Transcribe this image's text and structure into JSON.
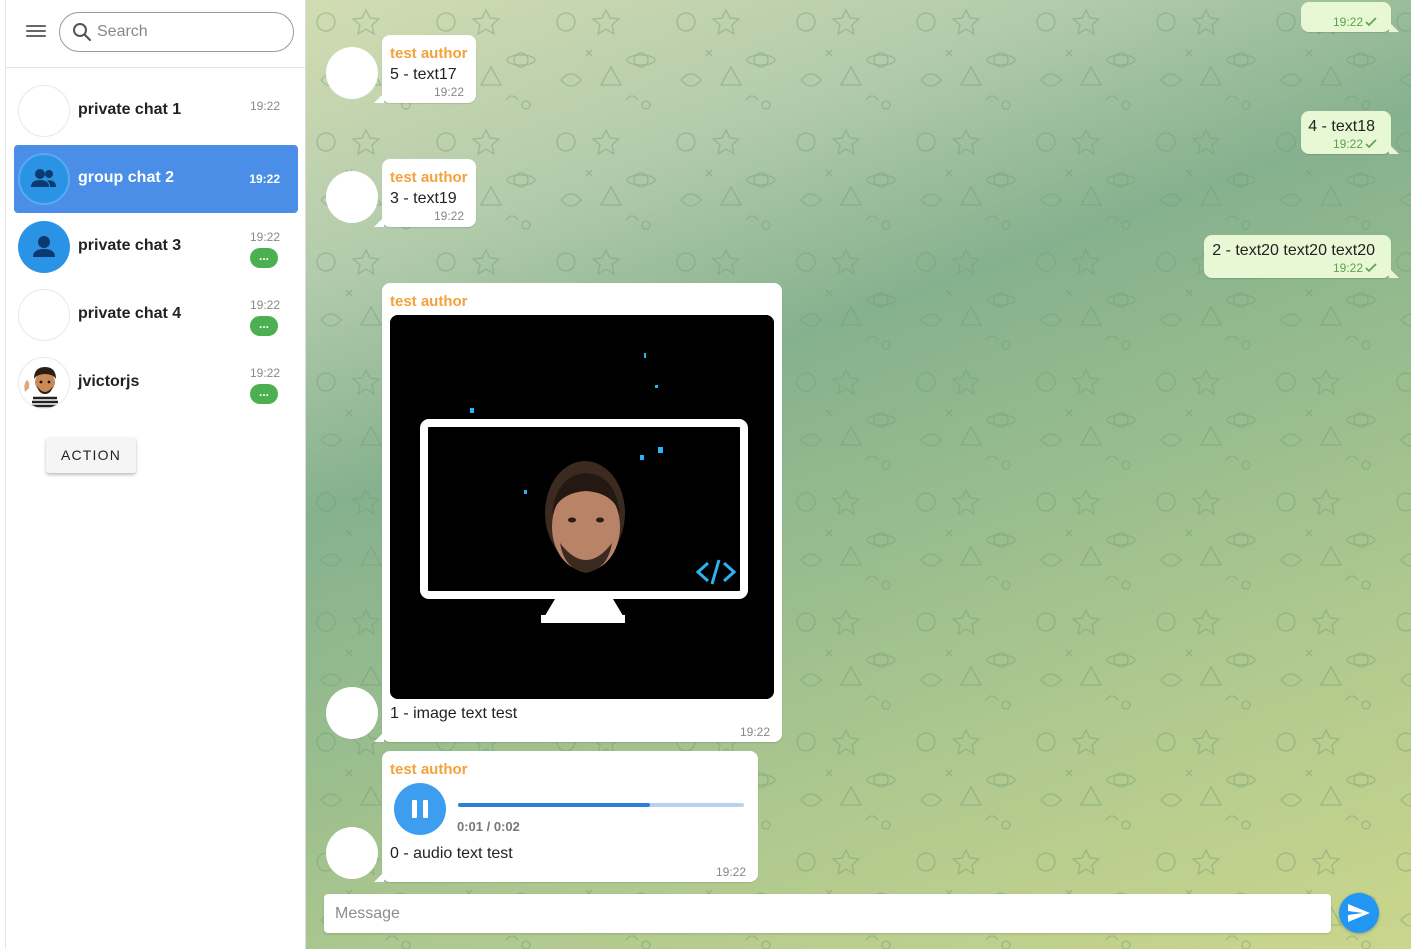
{
  "sidebar": {
    "search": {
      "placeholder": "Search"
    },
    "chats": [
      {
        "name": "private chat 1",
        "time": "19:22",
        "badge": "",
        "avatar": "blank"
      },
      {
        "name": "group chat 2",
        "time": "19:22",
        "badge": "",
        "avatar": "group-icon",
        "active": true
      },
      {
        "name": "private chat 3",
        "time": "19:22",
        "badge": "...",
        "avatar": "person-icon"
      },
      {
        "name": "private chat 4",
        "time": "19:22",
        "badge": "...",
        "avatar": "blank"
      },
      {
        "name": "jvictorjs",
        "time": "19:22",
        "badge": "...",
        "avatar": "photo"
      }
    ],
    "action_label": "ACTION"
  },
  "chat": {
    "messages": [
      {
        "direction": "out",
        "text": "",
        "time": "19:22"
      },
      {
        "direction": "in",
        "author": "test author",
        "text": "5 - text17",
        "time": "19:22"
      },
      {
        "direction": "out",
        "text": "4 - text18",
        "time": "19:22"
      },
      {
        "direction": "in",
        "author": "test author",
        "text": "3 - text19",
        "time": "19:22"
      },
      {
        "direction": "out",
        "text": "2 - text20 text20 text20",
        "time": "19:22"
      },
      {
        "direction": "in",
        "author": "test author",
        "type": "image",
        "text": "1 - image text test",
        "time": "19:22"
      },
      {
        "direction": "in",
        "author": "test author",
        "type": "audio",
        "text": "0 - audio text test",
        "time": "19:22",
        "audio": {
          "position": "0:01 / 0:02",
          "progress": 0.67
        }
      }
    ],
    "composer": {
      "placeholder": "Message"
    }
  },
  "colors": {
    "accent": "#4a8ee8",
    "author": "#f5a23a",
    "badge": "#4caf50",
    "outgoing": "#e8f7d4",
    "send": "#2196f3"
  },
  "icons": [
    "menu-icon",
    "search-icon",
    "group-icon",
    "person-icon",
    "pause-icon",
    "send-icon",
    "double-check-icon",
    "code-icon"
  ]
}
